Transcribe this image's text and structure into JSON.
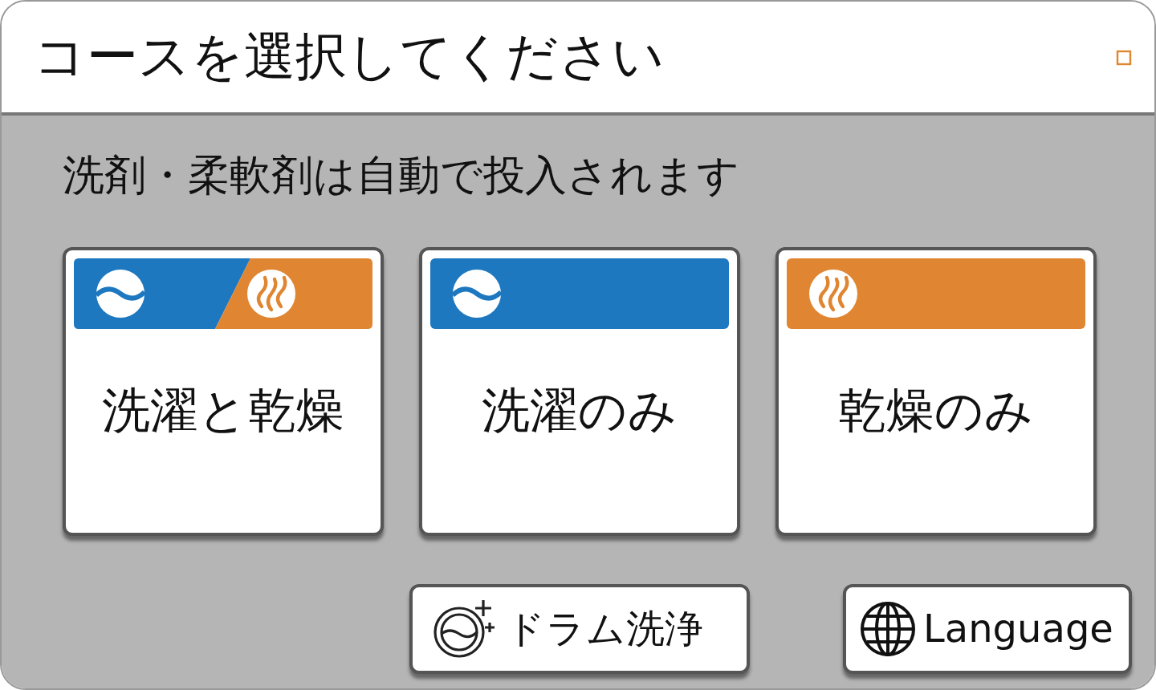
{
  "header": {
    "title": "コースを選択してください"
  },
  "notice": "洗剤・柔軟剤は自動で投入されます",
  "courses": [
    {
      "kind": "wash_dry",
      "label": "洗濯と乾燥"
    },
    {
      "kind": "wash",
      "label": "洗濯のみ"
    },
    {
      "kind": "dry",
      "label": "乾燥のみ"
    }
  ],
  "buttons": [
    {
      "kind": "drum",
      "label": "ドラム洗浄"
    },
    {
      "kind": "language",
      "label": "Language"
    }
  ]
}
